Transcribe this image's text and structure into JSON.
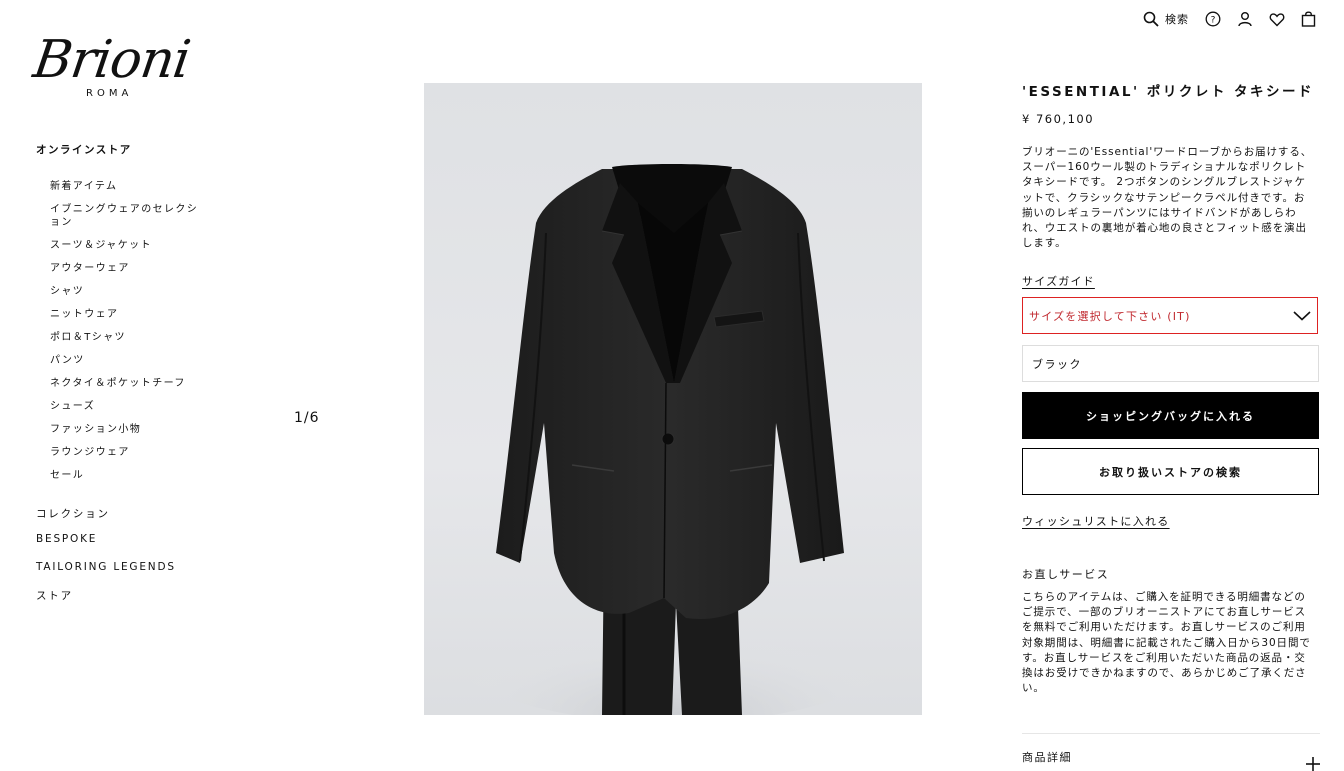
{
  "header": {
    "search_label": "検索",
    "icons": [
      "search-icon",
      "help-icon",
      "account-icon",
      "wishlist-heart-icon",
      "shopping-bag-icon"
    ]
  },
  "brand": {
    "logo_text": "Brioni",
    "logo_sub": "ROMA"
  },
  "sidebar": {
    "heading": "オンラインストア",
    "sub_items": [
      "新着アイテム",
      "イブニングウェアのセレクション",
      "スーツ＆ジャケット",
      "アウターウェア",
      "シャツ",
      "ニットウェア",
      "ポロ＆Tシャツ",
      "パンツ",
      "ネクタイ＆ポケットチーフ",
      "シューズ",
      "ファッション小物",
      "ラウンジウェア",
      "セール"
    ],
    "main_items": [
      "コレクション",
      "BESPOKE",
      "TAILORING LEGENDS",
      "ストア"
    ]
  },
  "gallery": {
    "counter": "1/6"
  },
  "product": {
    "title": "'ESSENTIAL' ポリクレト タキシード",
    "price": "¥ 760,100",
    "description": "ブリオーニの'Essential'ワードローブからお届けする、スーパー160ウール製のトラディショナルなポリクレトタキシードです。 2つボタンのシングルブレストジャケットで、クラシックなサテンピークラペル付きです。お揃いのレギュラーパンツにはサイドバンドがあしらわれ、ウエストの裏地が着心地の良さとフィット感を演出します。",
    "size_guide": "サイズガイド",
    "size_placeholder": "サイズを選択して下さい (IT)",
    "color": "ブラック",
    "add_to_bag": "ショッピングバッグに入れる",
    "find_store": "お取り扱いストアの検索",
    "wishlist": "ウィッシュリストに入れる",
    "alteration_title": "お直しサービス",
    "alteration_text": "こちらのアイテムは、ご購入を証明できる明細書などのご提示で、一部のブリオーニストアにてお直しサービスを無料でご利用いただけます。お直しサービスのご利用対象期間は、明細書に記載されたご購入日から30日間です。お直しサービスをご利用いただいた商品の返品・交換はお受けできかねますので、あらかじめご了承ください。",
    "details_label": "商品詳細"
  },
  "colors": {
    "accent_error": "#c0282e",
    "button_bg": "#000000",
    "photo_bg": "#e2e4e7"
  }
}
